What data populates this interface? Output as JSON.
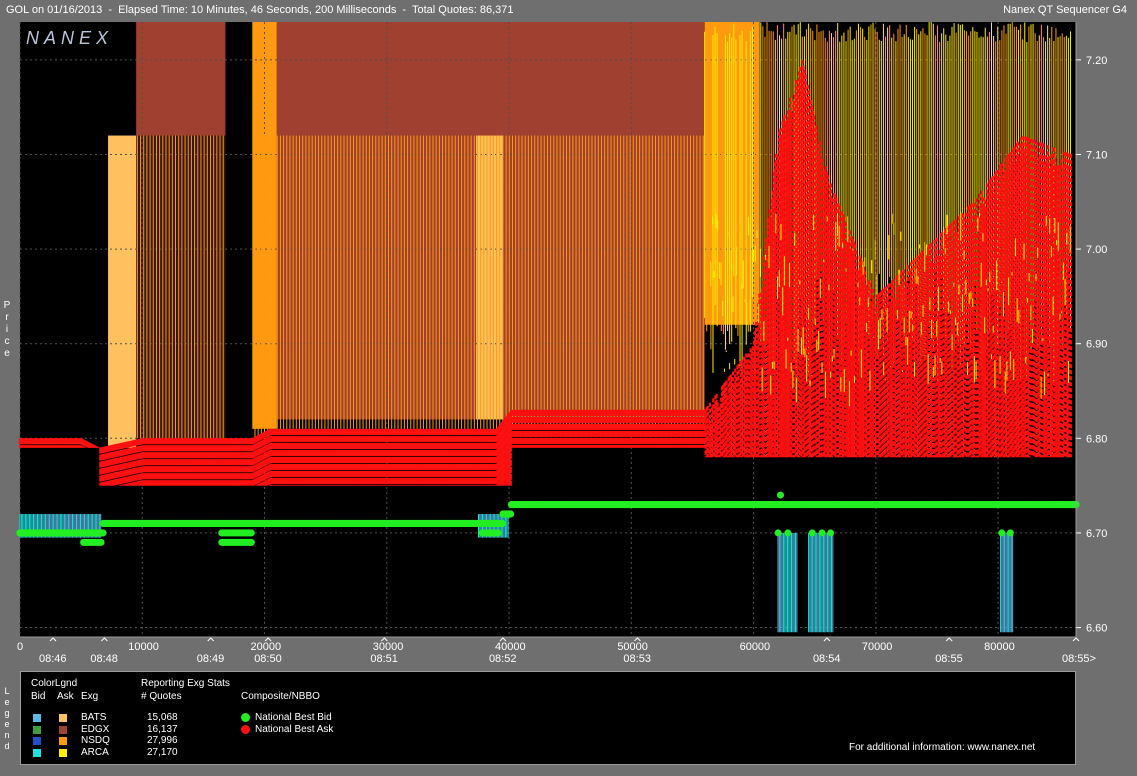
{
  "header": {
    "title": "GOL on 01/16/2013  -  Elapsed Time: 10 Minutes, 46 Seconds, 200 Milliseconds  -  Total Quotes: 86,371",
    "app_name": "Nanex QT Sequencer G4",
    "watermark": "NANEX"
  },
  "axis": {
    "ylabel": "Price",
    "y_ticks": [
      "7.20",
      "7.10",
      "7.00",
      "6.90",
      "6.80",
      "6.70",
      "6.60"
    ],
    "x_seq_ticks": [
      "0",
      "10000",
      "20000",
      "30000",
      "40000",
      "50000",
      "60000",
      "70000",
      "80000"
    ],
    "x_time_ticks": [
      "08:46",
      "08:48",
      "08:49",
      "08:50",
      "08:51",
      "08:52",
      "08:53",
      "08:54",
      "08:55",
      "08:55>"
    ]
  },
  "legend": {
    "side_label": "Legend",
    "color_legend_title": "ColorLgnd",
    "col_bid": "Bid",
    "col_ask": "Ask",
    "col_exg": "Exg",
    "stats_title": "Reporting Exg Stats",
    "stats_col": "# Quotes",
    "composite_title": "Composite/NBBO",
    "exchanges": [
      {
        "name": "BATS",
        "quotes": "15,068",
        "bid_color": "#5fb8e8",
        "ask_color": "#ffc060"
      },
      {
        "name": "EDGX",
        "quotes": "16,137",
        "bid_color": "#40a040",
        "ask_color": "#a04030"
      },
      {
        "name": "NSDQ",
        "quotes": "27,996",
        "bid_color": "#2050d0",
        "ask_color": "#ff9a10"
      },
      {
        "name": "ARCA",
        "quotes": "27,170",
        "bid_color": "#20e0e0",
        "ask_color": "#ffee00"
      }
    ],
    "nbbo": [
      {
        "name": "National Best Bid",
        "color": "#22ee22"
      },
      {
        "name": "National Best Ask",
        "color": "#ff1010"
      }
    ],
    "footer": "For additional information: www.nanex.net"
  },
  "chart_data": {
    "type": "scatter",
    "x_range": [
      0,
      86371
    ],
    "ylim": [
      6.59,
      7.24
    ],
    "series": [
      {
        "name": "National Best Bid",
        "color": "#22ee22",
        "x": [
          0,
          3000,
          6800,
          10000,
          16500,
          20000,
          30000,
          37500,
          39500,
          40200,
          50000,
          60000,
          70000,
          80000,
          86371
        ],
        "y": [
          6.7,
          6.7,
          6.71,
          6.71,
          6.71,
          6.71,
          6.71,
          6.71,
          6.72,
          6.73,
          6.73,
          6.73,
          6.73,
          6.73,
          6.73
        ]
      },
      {
        "name": "National Best Ask",
        "color": "#ff1010",
        "x": [
          0,
          5000,
          6500,
          10000,
          15000,
          19000,
          20500,
          30000,
          39000,
          40200,
          50000,
          56000,
          60000,
          62000,
          64000,
          66000,
          70000,
          74000,
          78000,
          82000,
          86000
        ],
        "y": [
          6.8,
          6.8,
          6.79,
          6.8,
          6.8,
          6.8,
          6.81,
          6.81,
          6.81,
          6.83,
          6.83,
          6.83,
          6.9,
          7.12,
          7.2,
          7.08,
          6.95,
          7.0,
          7.05,
          7.12,
          7.1
        ]
      }
    ]
  }
}
